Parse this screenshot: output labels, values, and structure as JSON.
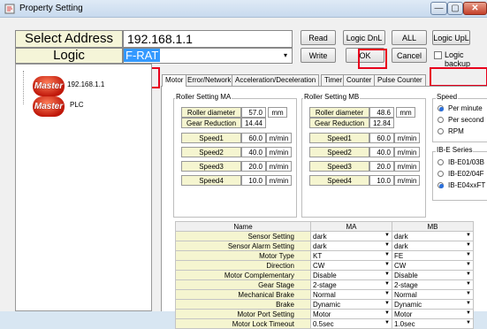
{
  "window": {
    "title": "Property Setting",
    "btn_min": "—",
    "btn_max": "▢",
    "btn_close": "✕"
  },
  "top": {
    "select_address_label": "Select Address",
    "address_value": "192.168.1.1",
    "logic_label": "Logic",
    "logic_value": "F-RAT"
  },
  "buttons": {
    "read": "Read",
    "logic_dnl": "Logic DnL",
    "all": "ALL",
    "logic_upl": "Logic UpL",
    "write": "Write",
    "ok": "OK",
    "cancel": "Cancel",
    "logic_backup": "Logic backup"
  },
  "tree": {
    "items": [
      {
        "badge": "Master",
        "label": "192.168.1.1"
      },
      {
        "badge": "Master",
        "label": "PLC"
      }
    ]
  },
  "tabs": [
    "Motor",
    "Error/Network",
    "Acceleration/Deceleration",
    "Timer",
    "Counter",
    "Pulse Counter"
  ],
  "roller_ma": {
    "title": "Roller Setting MA",
    "diameter_label": "Roller diameter",
    "diameter_value": "57.0",
    "diameter_unit": "mm",
    "gear_label": "Gear Reduction",
    "gear_value": "14.44",
    "speeds": [
      {
        "label": "Speed1",
        "value": "60.0",
        "unit": "m/min"
      },
      {
        "label": "Speed2",
        "value": "40.0",
        "unit": "m/min"
      },
      {
        "label": "Speed3",
        "value": "20.0",
        "unit": "m/min"
      },
      {
        "label": "Speed4",
        "value": "10.0",
        "unit": "m/min"
      }
    ]
  },
  "roller_mb": {
    "title": "Roller Setting MB",
    "diameter_label": "Roller diameter",
    "diameter_value": "48.6",
    "diameter_unit": "mm",
    "gear_label": "Gear Reduction",
    "gear_value": "12.84",
    "speeds": [
      {
        "label": "Speed1",
        "value": "60.0",
        "unit": "m/min"
      },
      {
        "label": "Speed2",
        "value": "40.0",
        "unit": "m/min"
      },
      {
        "label": "Speed3",
        "value": "20.0",
        "unit": "m/min"
      },
      {
        "label": "Speed4",
        "value": "10.0",
        "unit": "m/min"
      }
    ]
  },
  "speed_group": {
    "title": "Speed",
    "options": [
      "Per minute",
      "Per second",
      "RPM"
    ],
    "selected": 0
  },
  "series_group": {
    "title": "IB-E Series",
    "options": [
      "IB-E01/03B",
      "IB-E02/04F",
      "IB-E04xxFT"
    ],
    "selected": 2
  },
  "grid": {
    "headers": [
      "Name",
      "MA",
      "MB"
    ],
    "rows": [
      {
        "name": "Sensor Setting",
        "ma": "dark",
        "mb": "dark"
      },
      {
        "name": "Sensor Alarm Setting",
        "ma": "dark",
        "mb": "dark"
      },
      {
        "name": "Motor Type",
        "ma": "KT",
        "mb": "FE"
      },
      {
        "name": "Direction",
        "ma": "CW",
        "mb": "CW"
      },
      {
        "name": "Motor Complementary",
        "ma": "Disable",
        "mb": "Disable"
      },
      {
        "name": "Gear Stage",
        "ma": "2-stage",
        "mb": "2-stage"
      },
      {
        "name": "Mechanical Brake",
        "ma": "Normal",
        "mb": "Normal"
      },
      {
        "name": "Brake",
        "ma": "Dynamic",
        "mb": "Dynamic"
      },
      {
        "name": "Motor Port Setting",
        "ma": "Motor",
        "mb": "Motor"
      },
      {
        "name": "Motor Lock Timeout",
        "ma": "0.5sec",
        "mb": "1.0sec"
      }
    ]
  },
  "colors": {
    "accent": "#3399ff",
    "highlight": "#e8001c",
    "label_bg": "#f5f5d0"
  }
}
